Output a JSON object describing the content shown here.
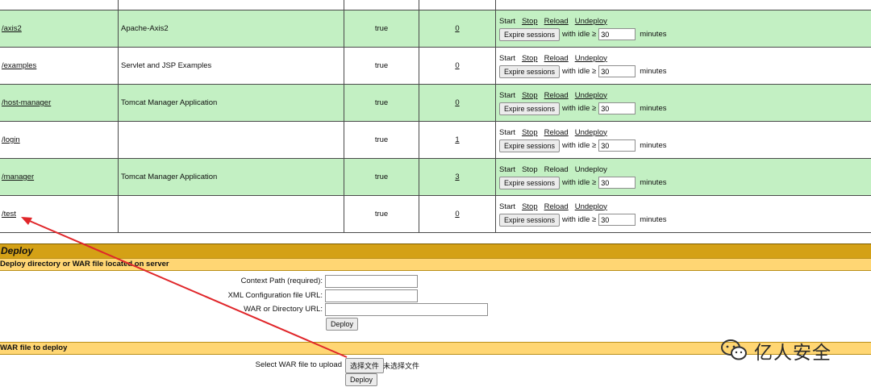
{
  "apps": [
    {
      "path": "",
      "name": "",
      "running": "",
      "sessions": "",
      "commands": null,
      "row": "white",
      "top": true
    },
    {
      "path": "/axis2",
      "name": "Apache-Axis2",
      "running": "true",
      "sessions": "0",
      "row": "green",
      "commands": [
        "Start",
        "Stop",
        "Reload",
        "Undeploy"
      ],
      "links": [
        false,
        true,
        true,
        true
      ]
    },
    {
      "path": "/examples",
      "name": "Servlet and JSP Examples",
      "running": "true",
      "sessions": "0",
      "row": "white",
      "commands": [
        "Start",
        "Stop",
        "Reload",
        "Undeploy"
      ],
      "links": [
        false,
        true,
        true,
        true
      ]
    },
    {
      "path": "/host-manager",
      "name": "Tomcat Manager Application",
      "running": "true",
      "sessions": "0",
      "row": "green",
      "commands": [
        "Start",
        "Stop",
        "Reload",
        "Undeploy"
      ],
      "links": [
        false,
        true,
        true,
        true
      ]
    },
    {
      "path": "/login",
      "name": "",
      "running": "true",
      "sessions": "1",
      "row": "white",
      "commands": [
        "Start",
        "Stop",
        "Reload",
        "Undeploy"
      ],
      "links": [
        false,
        true,
        true,
        true
      ]
    },
    {
      "path": "/manager",
      "name": "Tomcat Manager Application",
      "running": "true",
      "sessions": "3",
      "row": "green",
      "commands": [
        "Start",
        "Stop",
        "Reload",
        "Undeploy"
      ],
      "links": [
        false,
        false,
        false,
        false
      ]
    },
    {
      "path": "/test",
      "name": "",
      "running": "true",
      "sessions": "0",
      "row": "white",
      "commands": [
        "Start",
        "Stop",
        "Reload",
        "Undeploy"
      ],
      "links": [
        false,
        true,
        true,
        true
      ]
    }
  ],
  "expire": {
    "button": "Expire sessions",
    "with_idle": "with idle ≥",
    "value": "30",
    "unit": "minutes"
  },
  "deploy": {
    "title": "Deploy",
    "dir_section": "Deploy directory or WAR file located on server",
    "context_label": "Context Path (required):",
    "xml_label": "XML Configuration file URL:",
    "war_dir_label": "WAR or Directory URL:",
    "deploy_button": "Deploy",
    "war_section": "WAR file to deploy",
    "select_label": "Select WAR file to upload",
    "choose_button": "选择文件",
    "no_file": "未选择文件",
    "deploy_button2": "Deploy"
  },
  "watermark": {
    "text": "亿人安全",
    "icon": "wechat-icon"
  },
  "colors": {
    "green_row": "#c3f0c3",
    "deploy_header": "#d4a116",
    "subsection": "#ffd673",
    "arrow": "#e0262a"
  }
}
